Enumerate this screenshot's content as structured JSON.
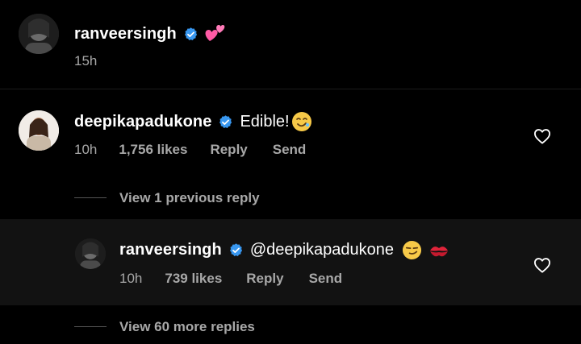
{
  "post": {
    "username": "ranveersingh",
    "time": "15h",
    "emoji": "💕"
  },
  "comment": {
    "username": "deepikapadukone",
    "text": "Edible!",
    "time": "10h",
    "likes": "1,756 likes",
    "reply_label": "Reply",
    "send_label": "Send",
    "view_previous": "View 1 previous reply"
  },
  "reply": {
    "username": "ranveersingh",
    "text": "@deepikapadukone",
    "time": "10h",
    "likes": "739 likes",
    "reply_label": "Reply",
    "send_label": "Send",
    "view_more": "View 60 more replies"
  },
  "colors": {
    "background": "#000000",
    "reply_background": "#121212",
    "verified_blue": "#3897f0",
    "secondary_text": "#a8a8a8"
  },
  "icons": [
    "verified-badge-icon",
    "heart-outline-icon",
    "two-hearts-emoji",
    "smiling-emoji",
    "smirk-emoji",
    "kiss-mark-emoji"
  ]
}
